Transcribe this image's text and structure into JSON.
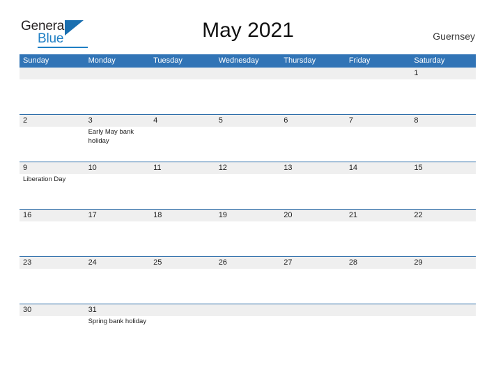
{
  "logo": {
    "word_top": "General",
    "word_bottom": "Blue",
    "triangle_icon": "blue-triangle-icon",
    "accent_color": "#1f7fc4"
  },
  "header": {
    "title": "May 2021",
    "country": "Guernsey"
  },
  "theme": {
    "header_blue": "#3174b6",
    "divider_blue": "#2b6ca8",
    "daynum_band_gray": "#efefef"
  },
  "weekdays": [
    "Sunday",
    "Monday",
    "Tuesday",
    "Wednesday",
    "Thursday",
    "Friday",
    "Saturday"
  ],
  "weeks": [
    {
      "days": [
        {
          "num": "",
          "events": []
        },
        {
          "num": "",
          "events": []
        },
        {
          "num": "",
          "events": []
        },
        {
          "num": "",
          "events": []
        },
        {
          "num": "",
          "events": []
        },
        {
          "num": "",
          "events": []
        },
        {
          "num": "1",
          "events": []
        }
      ]
    },
    {
      "days": [
        {
          "num": "2",
          "events": []
        },
        {
          "num": "3",
          "events": [
            "Early May bank holiday"
          ]
        },
        {
          "num": "4",
          "events": []
        },
        {
          "num": "5",
          "events": []
        },
        {
          "num": "6",
          "events": []
        },
        {
          "num": "7",
          "events": []
        },
        {
          "num": "8",
          "events": []
        }
      ]
    },
    {
      "days": [
        {
          "num": "9",
          "events": [
            "Liberation Day"
          ]
        },
        {
          "num": "10",
          "events": []
        },
        {
          "num": "11",
          "events": []
        },
        {
          "num": "12",
          "events": []
        },
        {
          "num": "13",
          "events": []
        },
        {
          "num": "14",
          "events": []
        },
        {
          "num": "15",
          "events": []
        }
      ]
    },
    {
      "days": [
        {
          "num": "16",
          "events": []
        },
        {
          "num": "17",
          "events": []
        },
        {
          "num": "18",
          "events": []
        },
        {
          "num": "19",
          "events": []
        },
        {
          "num": "20",
          "events": []
        },
        {
          "num": "21",
          "events": []
        },
        {
          "num": "22",
          "events": []
        }
      ]
    },
    {
      "days": [
        {
          "num": "23",
          "events": []
        },
        {
          "num": "24",
          "events": []
        },
        {
          "num": "25",
          "events": []
        },
        {
          "num": "26",
          "events": []
        },
        {
          "num": "27",
          "events": []
        },
        {
          "num": "28",
          "events": []
        },
        {
          "num": "29",
          "events": []
        }
      ]
    },
    {
      "days": [
        {
          "num": "30",
          "events": []
        },
        {
          "num": "31",
          "events": [
            "Spring bank holiday"
          ]
        },
        {
          "num": "",
          "events": []
        },
        {
          "num": "",
          "events": []
        },
        {
          "num": "",
          "events": []
        },
        {
          "num": "",
          "events": []
        },
        {
          "num": "",
          "events": []
        }
      ]
    }
  ]
}
